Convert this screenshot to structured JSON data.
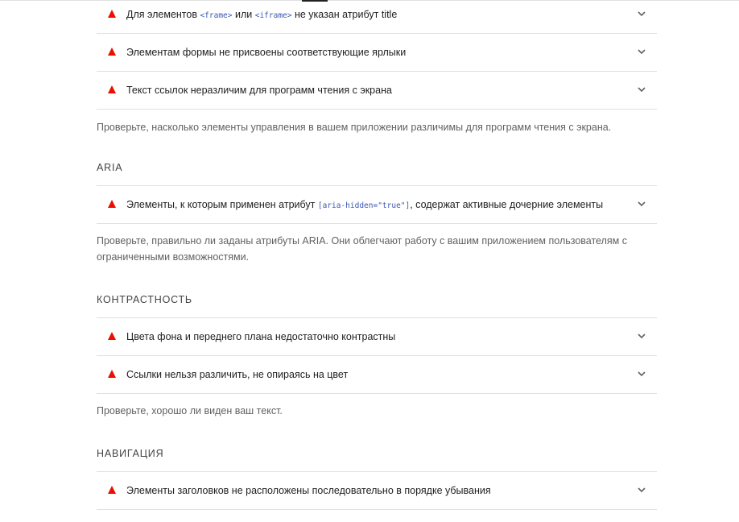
{
  "sections": [
    {
      "audits": [
        {
          "parts": [
            {
              "t": "Для элементов "
            },
            {
              "c": "<frame>"
            },
            {
              "t": " или "
            },
            {
              "c": "<iframe>"
            },
            {
              "t": " не указан атрибут title"
            }
          ]
        },
        {
          "parts": [
            {
              "t": "Элементам формы не присвоены соответствующие ярлыки"
            }
          ]
        },
        {
          "parts": [
            {
              "t": "Текст ссылок неразличим для программ чтения с экрана"
            }
          ]
        }
      ],
      "description": "Проверьте, насколько элементы управления в вашем приложении различимы для программ чтения с экрана."
    },
    {
      "title": "ARIA",
      "audits": [
        {
          "parts": [
            {
              "t": "Элементы, к которым применен атрибут "
            },
            {
              "c": "[aria-hidden=\"true\"]"
            },
            {
              "t": ", содержат активные дочерние элементы"
            }
          ]
        }
      ],
      "description": "Проверьте, правильно ли заданы атрибуты ARIA. Они облегчают работу с вашим приложением пользователям с ограниченными возможностями."
    },
    {
      "title": "КОНТРАСТНОСТЬ",
      "audits": [
        {
          "parts": [
            {
              "t": "Цвета фона и переднего плана недостаточно контрастны"
            }
          ]
        },
        {
          "parts": [
            {
              "t": "Ссылки нельзя различить, не опираясь на цвет"
            }
          ]
        }
      ],
      "description": "Проверьте, хорошо ли виден ваш текст."
    },
    {
      "title": "НАВИГАЦИЯ",
      "audits": [
        {
          "parts": [
            {
              "t": "Элементы заголовков не расположены последовательно в порядке убывания"
            }
          ]
        }
      ]
    }
  ],
  "icons": {
    "fail": "warning-triangle-icon",
    "expand": "chevron-down-icon"
  },
  "colors": {
    "fail": "#eb0f00",
    "code": "#3c57b3",
    "divider": "#e0e0e0",
    "description": "#616161"
  }
}
